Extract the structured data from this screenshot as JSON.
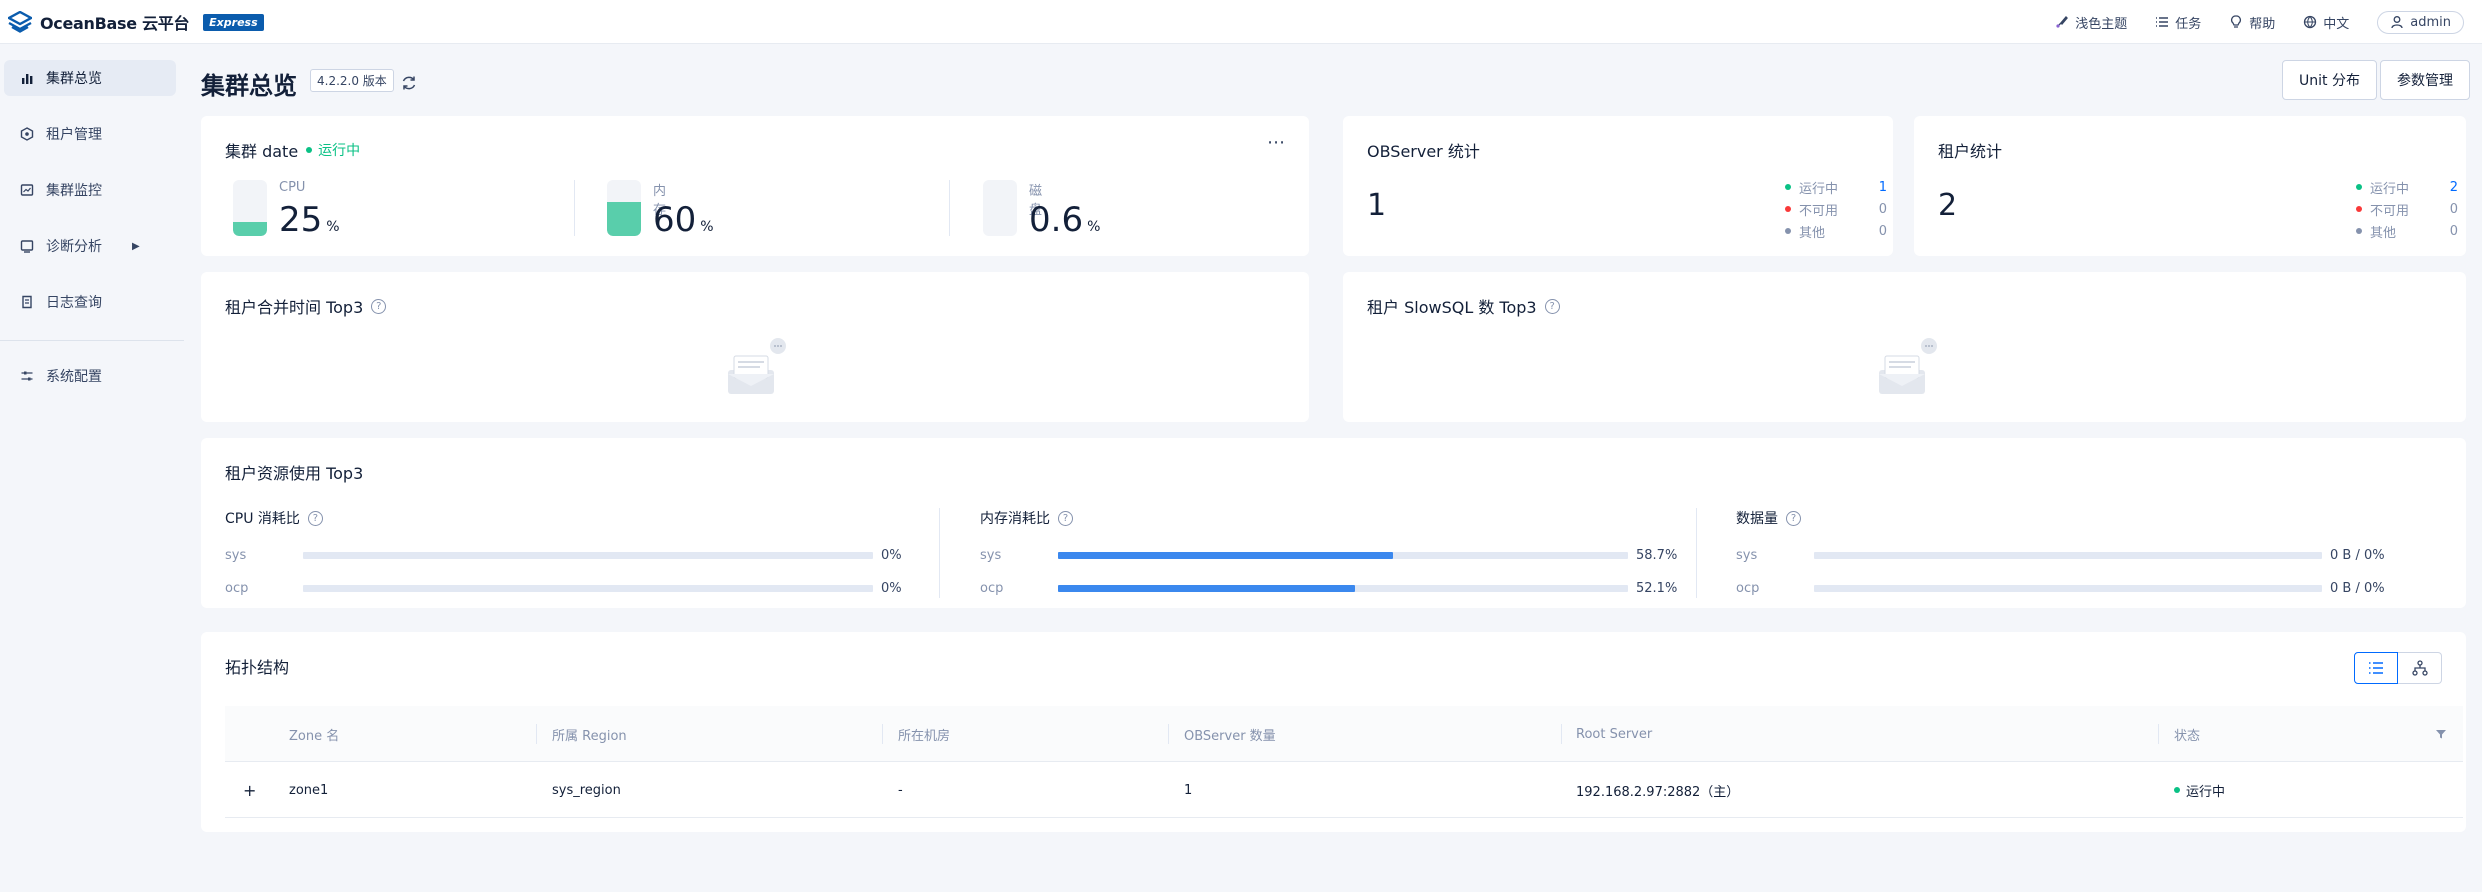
{
  "app": {
    "name": "OceanBase 云平台",
    "edition": "Express"
  },
  "topbar": {
    "theme": "浅色主题",
    "tasks": "任务",
    "help": "帮助",
    "language": "中文",
    "user": "admin"
  },
  "sidebar": {
    "items": [
      {
        "label": "集群总览",
        "icon": "bar-chart-icon",
        "active": true
      },
      {
        "label": "租户管理",
        "icon": "tenant-icon"
      },
      {
        "label": "集群监控",
        "icon": "monitor-icon"
      },
      {
        "label": "诊断分析",
        "icon": "diagnose-icon",
        "submenu": true
      },
      {
        "label": "日志查询",
        "icon": "log-icon"
      },
      {
        "label": "系统配置",
        "icon": "settings-sliders-icon"
      }
    ]
  },
  "header": {
    "title": "集群总览",
    "version": "4.2.2.0 版本",
    "unit_button": "Unit 分布",
    "param_button": "参数管理"
  },
  "cluster": {
    "title": "集群 date",
    "status": "运行中",
    "cpu": {
      "label": "CPU",
      "value": "25",
      "unit": "%",
      "fraction": 0.25
    },
    "memory": {
      "label": "内存",
      "value": "60",
      "unit": "%",
      "fraction": 0.6
    },
    "disk": {
      "label": "磁盘",
      "value": "0.6",
      "unit": "%",
      "fraction": 0.006
    }
  },
  "observer_stats": {
    "title": "OBServer 统计",
    "total": "1",
    "running_label": "运行中",
    "running": "1",
    "unavailable_label": "不可用",
    "unavailable": "0",
    "other_label": "其他",
    "other": "0"
  },
  "tenant_stats": {
    "title": "租户统计",
    "total": "2",
    "running_label": "运行中",
    "running": "2",
    "unavailable_label": "不可用",
    "unavailable": "0",
    "other_label": "其他",
    "other": "0"
  },
  "merge_top3": {
    "title": "租户合并时间 Top3"
  },
  "slowsql_top3": {
    "title": "租户 SlowSQL 数 Top3"
  },
  "resource_top3": {
    "title": "租户资源使用 Top3",
    "cpu": {
      "title": "CPU 消耗比",
      "rows": [
        {
          "name": "sys",
          "pct": "0%",
          "fraction": 0
        },
        {
          "name": "ocp",
          "pct": "0%",
          "fraction": 0
        }
      ]
    },
    "memory": {
      "title": "内存消耗比",
      "rows": [
        {
          "name": "sys",
          "pct": "58.7%",
          "fraction": 0.587
        },
        {
          "name": "ocp",
          "pct": "52.1%",
          "fraction": 0.521
        }
      ]
    },
    "data": {
      "title": "数据量",
      "rows": [
        {
          "name": "sys",
          "pct": "0 B / 0%",
          "fraction": 0
        },
        {
          "name": "ocp",
          "pct": "0 B / 0%",
          "fraction": 0
        }
      ]
    }
  },
  "topology": {
    "title": "拓扑结构",
    "columns": [
      "Zone 名",
      "所属 Region",
      "所在机房",
      "OBServer 数量",
      "Root Server",
      "状态"
    ],
    "rows": [
      {
        "expand": "+",
        "zone": "zone1",
        "region": "sys_region",
        "idc": "-",
        "count": "1",
        "root": "192.168.2.97:2882（主）",
        "status": "运行中"
      }
    ]
  },
  "colors": {
    "running": "#0ac185",
    "unavailable": "#f93939",
    "other": "#8592ad",
    "accent": "#006aff",
    "bar": "#3b88ee",
    "gauge": "#59ceab"
  }
}
